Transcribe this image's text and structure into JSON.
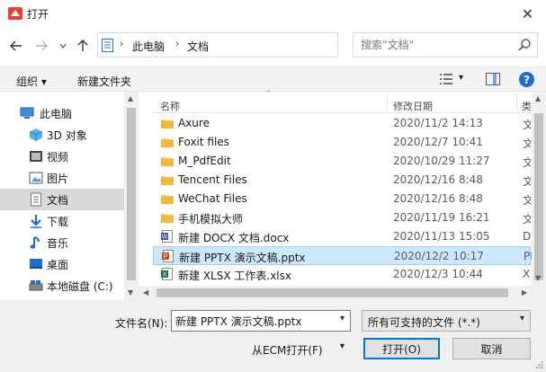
{
  "window": {
    "title": "打开",
    "close_label": "✕"
  },
  "nav": {
    "breadcrumbs": [
      "此电脑",
      "文档"
    ],
    "search_placeholder": "搜索\"文档\""
  },
  "toolbar": {
    "organize_label": "组织 ▾",
    "newfolder_label": "新建文件夹",
    "view_label": "▾",
    "help_label": "?"
  },
  "sidebar": {
    "items": [
      {
        "label": "此电脑",
        "icon": "computer-icon"
      },
      {
        "label": "3D 对象",
        "icon": "cube-icon"
      },
      {
        "label": "视频",
        "icon": "video-icon"
      },
      {
        "label": "图片",
        "icon": "picture-icon"
      },
      {
        "label": "文档",
        "icon": "document-icon",
        "selected": true
      },
      {
        "label": "下载",
        "icon": "download-icon"
      },
      {
        "label": "音乐",
        "icon": "music-icon"
      },
      {
        "label": "桌面",
        "icon": "desktop-icon"
      },
      {
        "label": "本地磁盘 (C:)",
        "icon": "drive-icon"
      }
    ]
  },
  "filelist": {
    "columns": {
      "name": "名称",
      "date": "修改日期",
      "type": "类"
    },
    "rows": [
      {
        "name": "Axure",
        "date": "2020/11/2 14:13",
        "type": "文",
        "icon": "folder-icon"
      },
      {
        "name": "Foxit files",
        "date": "2020/12/7 10:41",
        "type": "文",
        "icon": "folder-icon"
      },
      {
        "name": "M_PdfEdit",
        "date": "2020/10/29 11:27",
        "type": "文",
        "icon": "folder-icon"
      },
      {
        "name": "Tencent Files",
        "date": "2020/12/16 8:48",
        "type": "文",
        "icon": "folder-icon"
      },
      {
        "name": "WeChat Files",
        "date": "2020/12/16 8:48",
        "type": "文",
        "icon": "folder-icon"
      },
      {
        "name": "手机模拟大师",
        "date": "2020/11/19 16:21",
        "type": "文",
        "icon": "folder-icon"
      },
      {
        "name": "新建 DOCX 文档.docx",
        "date": "2020/11/13 15:05",
        "type": "Do",
        "icon": "word-doc-icon"
      },
      {
        "name": "新建 PPTX 演示文稿.pptx",
        "date": "2020/12/2 10:17",
        "type": "PP",
        "icon": "ppt-doc-icon",
        "selected": true
      },
      {
        "name": "新建 XLSX 工作表.xlsx",
        "date": "2020/12/3 10:44",
        "type": "XL",
        "icon": "excel-doc-icon"
      }
    ]
  },
  "bottom": {
    "filename_label": "文件名(N):",
    "filename_value": "新建 PPTX 演示文稿.pptx",
    "filetype_value": "所有可支持的文件 (*.*)",
    "ecm_label": "从ECM打开(F)",
    "open_label": "打开(O)",
    "cancel_label": "取消"
  }
}
